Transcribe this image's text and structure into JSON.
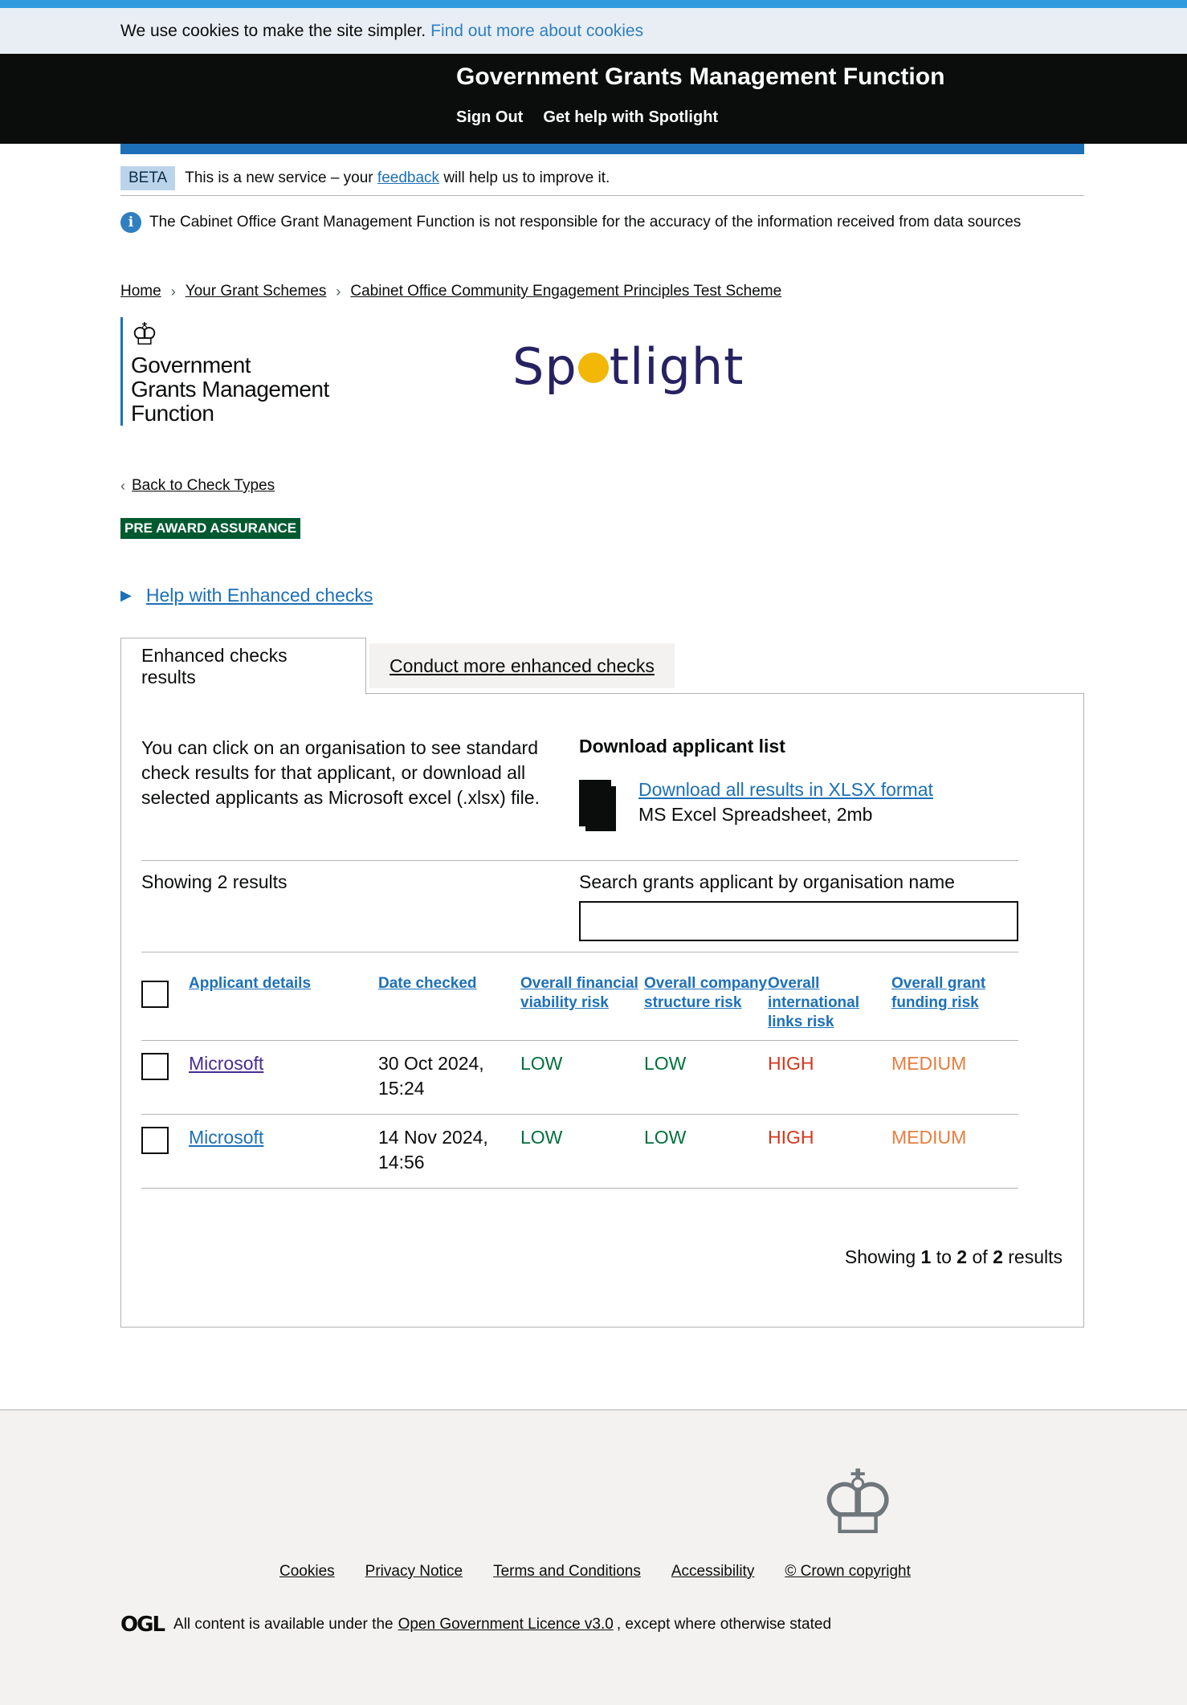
{
  "cookie_banner": {
    "text": "We use cookies to make the site simpler.",
    "link": "Find out more about cookies"
  },
  "header": {
    "service_name": "Government Grants Management Function",
    "nav": [
      "Sign Out",
      "Get help with Spotlight"
    ]
  },
  "beta": {
    "tag": "BETA",
    "text_before": "This is a new service – your",
    "link": "feedback",
    "text_after": "will help us to improve it."
  },
  "info": {
    "text": "The Cabinet Office Grant Management Function is not responsible for the accuracy of the information received from data sources"
  },
  "breadcrumb": [
    "Home",
    "Your Grant Schemes",
    "Cabinet Office Community Engagement Principles Test Scheme"
  ],
  "logo": {
    "lines": [
      "Government",
      "Grants Management",
      "Function"
    ],
    "spotlight_before": "Sp",
    "spotlight_after": "tlight"
  },
  "back_link": "Back to Check Types",
  "assurance_tag": "PRE AWARD ASSURANCE",
  "help_details": "Help with Enhanced checks",
  "tabs": [
    {
      "label": "Enhanced checks results",
      "active": true
    },
    {
      "label": "Conduct more enhanced checks",
      "active": false
    }
  ],
  "panel": {
    "intro": "You can click on an organisation to see standard check results for that applicant, or download all selected applicants as Microsoft excel (.xlsx) file.",
    "download_title": "Download applicant list",
    "download_link": "Download all results in XLSX format",
    "download_meta": "MS Excel Spreadsheet, 2mb",
    "showing": "Showing 2 results",
    "search_label": "Search grants applicant by organisation name",
    "search_value": ""
  },
  "table": {
    "headers": [
      "Applicant details",
      "Date checked",
      "Overall financial viability risk",
      "Overall company structure risk",
      "Overall international links risk",
      "Overall grant funding risk"
    ],
    "rows": [
      {
        "org": "Microsoft",
        "date": "30 Oct 2024, 15:24",
        "financial": "LOW",
        "company": "LOW",
        "international": "HIGH",
        "grant": "MEDIUM"
      },
      {
        "org": "Microsoft",
        "date": "14 Nov 2024, 14:56",
        "financial": "LOW",
        "company": "LOW",
        "international": "HIGH",
        "grant": "MEDIUM"
      }
    ]
  },
  "pagination": {
    "showing": "Showing",
    "from": "1",
    "to_word": "to",
    "to": "2",
    "of_word": "of",
    "total": "2",
    "results": "results"
  },
  "footer": {
    "links": [
      "Cookies",
      "Privacy Notice",
      "Terms and Conditions",
      "Accessibility",
      "© Crown copyright"
    ],
    "ogl": "OGL",
    "licence_before": "All content is available under the",
    "licence_link": "Open Government Licence v3.0",
    "licence_after": ", except where otherwise stated"
  },
  "colors": {
    "link": "#1d70b8",
    "low": "#00703c",
    "high": "#d4351c",
    "medium": "#e87d3e",
    "tag_green": "#005a30"
  }
}
